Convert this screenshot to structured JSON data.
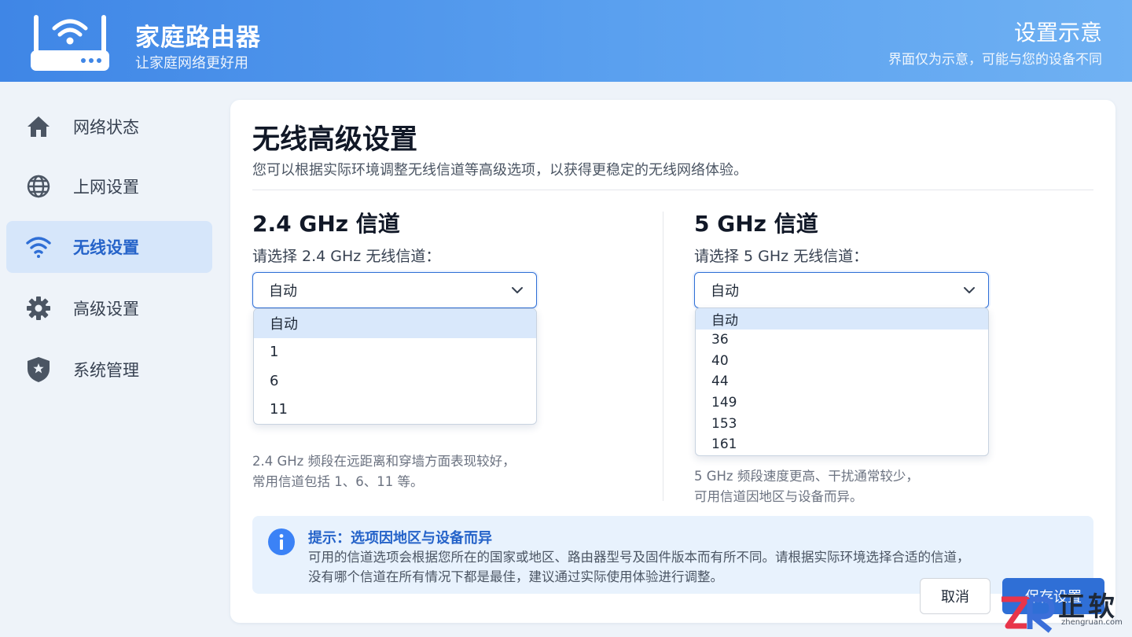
{
  "header": {
    "brand_title": "家庭路由器",
    "brand_subtitle": "让家庭网络更好用",
    "demo_title": "设置示意",
    "demo_subtitle": "界面仅为示意，可能与您的设备不同"
  },
  "sidebar": {
    "items": [
      {
        "label": "网络状态",
        "icon": "home-icon"
      },
      {
        "label": "上网设置",
        "icon": "globe-icon"
      },
      {
        "label": "无线设置",
        "icon": "wifi-icon",
        "active": true
      },
      {
        "label": "高级设置",
        "icon": "gear-icon"
      },
      {
        "label": "系统管理",
        "icon": "shield-icon"
      }
    ]
  },
  "main": {
    "title": "无线高级设置",
    "description": "您可以根据实际环境调整无线信道等高级选项，以获得更稳定的无线网络体验。",
    "band24": {
      "title": "2.4 GHz 信道",
      "label": "请选择 2.4 GHz 无线信道：",
      "selected": "自动",
      "options": [
        "自动",
        "1",
        "6",
        "11"
      ],
      "note_line1": "2.4 GHz 频段在远距离和穿墙方面表现较好，",
      "note_line2": "常用信道包括 1、6、11 等。"
    },
    "band5": {
      "title": "5 GHz 信道",
      "label": "请选择 5 GHz 无线信道：",
      "selected": "自动",
      "options": [
        "自动",
        "36",
        "40",
        "44",
        "149",
        "153",
        "161"
      ],
      "note_line1": "5 GHz 频段速度更高、干扰通常较少，",
      "note_line2": "可用信道因地区与设备而异。"
    },
    "tip": {
      "title": "提示：选项因地区与设备而异",
      "line1": "可用的信道选项会根据您所在的国家或地区、路由器型号及固件版本而有所不同。请根据实际环境选择合适的信道，",
      "line2": "没有哪个信道在所有情况下都是最佳，建议通过实际使用体验进行调整。"
    },
    "buttons": {
      "cancel": "取消",
      "save": "保存设置"
    }
  },
  "watermark": {
    "text": "正软",
    "url": "zhengruan.com"
  },
  "colors": {
    "accent": "#2f6fd6",
    "header_gradient_start": "#3f86e6",
    "header_gradient_end": "#6fb1f3",
    "active_nav_bg": "#d6e6fa"
  }
}
